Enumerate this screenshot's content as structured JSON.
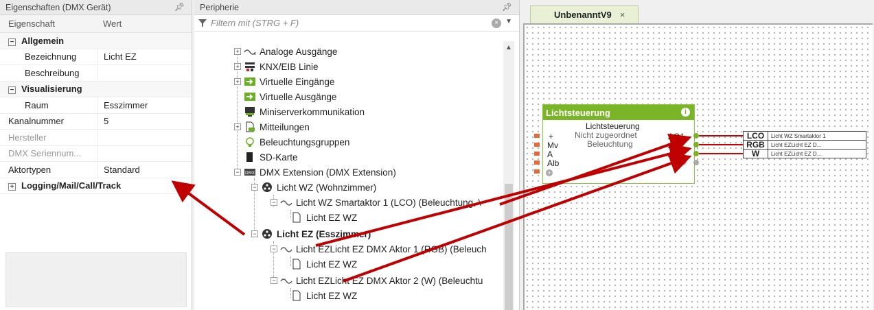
{
  "props": {
    "title": "Eigenschaften (DMX Gerät)",
    "pin": "И",
    "col_key": "Eigenschaft",
    "col_val": "Wert",
    "rows": [
      {
        "k": "Allgemein",
        "v": "",
        "group": true
      },
      {
        "k": "Bezeichnung",
        "v": "Licht EZ"
      },
      {
        "k": "Beschreibung",
        "v": ""
      },
      {
        "k": "Visualisierung",
        "v": "",
        "group": true
      },
      {
        "k": "Raum",
        "v": "Esszimmer"
      },
      {
        "k": "Kanalnummer",
        "v": "5"
      },
      {
        "k": "Hersteller",
        "v": ""
      },
      {
        "k": "DMX Seriennum...",
        "v": ""
      },
      {
        "k": "Aktortypen",
        "v": "Standard"
      },
      {
        "k": "Logging/Mail/Call/Track",
        "v": "",
        "group": true
      }
    ]
  },
  "peri": {
    "title": "Peripherie",
    "filter_placeholder": "Filtern mit (STRG + F)",
    "tree": [
      "Analoge Ausgänge",
      "KNX/EIB Linie",
      "Virtuelle Eingänge",
      "Virtuelle Ausgänge",
      "Miniserverkommunikation",
      "Mitteilungen",
      "Beleuchtungsgruppen",
      "SD-Karte",
      "DMX Extension (DMX Extension)",
      "Licht WZ (Wohnzimmer)",
      "Licht WZ Smartaktor 1 (LCO) (Beleuchtung, \\",
      "Licht EZ WZ",
      "Licht EZ (Esszimmer)",
      "Licht EZLicht EZ DMX Aktor 1 (RGB) (Beleuch",
      "Licht EZ WZ",
      "Licht EZLicht EZ DMX Aktor 2 (W) (Beleuchtu",
      "Licht EZ WZ"
    ]
  },
  "canvas": {
    "tab_title": "UnbenanntV9",
    "tab_close": "×",
    "block": {
      "title": "Lichtsteuerung",
      "info": "i",
      "subtitle": "Lichtsteuerung",
      "desc1": "Nicht zugeordnet",
      "desc2": "Beleuchtung",
      "inputs": [
        "+",
        "Mv",
        "A",
        "Alb"
      ],
      "outputs": [
        "AQ1",
        "AQ2",
        "AQ3"
      ]
    },
    "outs": [
      {
        "tag": "LCO",
        "name": "Licht WZ Smartaktor 1"
      },
      {
        "tag": "RGB",
        "name": "Licht EZLicht EZ D..."
      },
      {
        "tag": "W",
        "name": "Licht EZLicht EZ D..."
      }
    ]
  }
}
